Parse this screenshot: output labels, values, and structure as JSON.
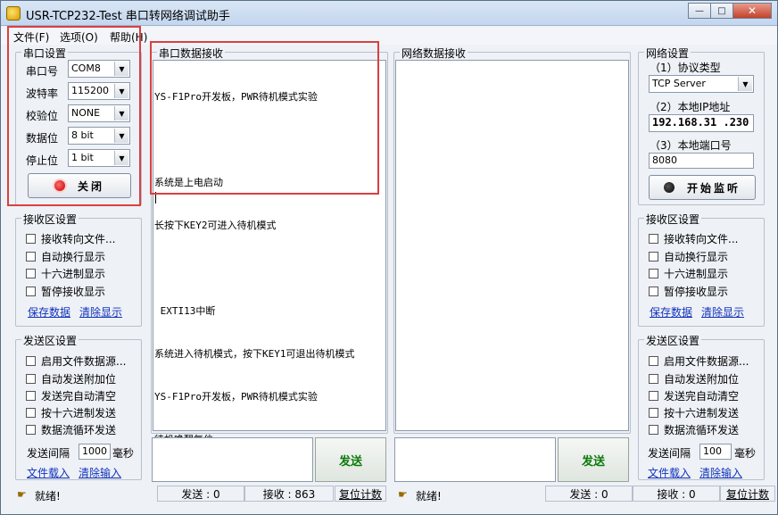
{
  "window": {
    "title": "USR-TCP232-Test 串口转网络调试助手",
    "buttons": {
      "minimize": "—",
      "maximize": "□",
      "close": "✕"
    }
  },
  "menu": [
    "文件(F)",
    "选项(O)",
    "帮助(H)"
  ],
  "serial_settings": {
    "title": "串口设置",
    "port": {
      "label": "串口号",
      "value": "COM8"
    },
    "baud": {
      "label": "波特率",
      "value": "115200"
    },
    "parity": {
      "label": "校验位",
      "value": "NONE"
    },
    "databits": {
      "label": "数据位",
      "value": "8 bit"
    },
    "stopbits": {
      "label": "停止位",
      "value": "1 bit"
    },
    "close_button": "关闭"
  },
  "serial_recv_settings": {
    "title": "接收区设置",
    "options": [
      "接收转向文件...",
      "自动换行显示",
      "十六进制显示",
      "暂停接收显示"
    ],
    "save_link": "保存数据",
    "clear_link": "清除显示"
  },
  "serial_send_settings": {
    "title": "发送区设置",
    "options": [
      "启用文件数据源...",
      "自动发送附加位",
      "发送完自动清空",
      "按十六进制发送",
      "数据流循环发送"
    ],
    "interval_label": "发送间隔",
    "interval_value": "1000",
    "interval_unit": "毫秒",
    "load_link": "文件载入",
    "clear_link": "清除输入"
  },
  "serial_recv": {
    "title": "串口数据接收",
    "lines": [
      "YS-F1Pro开发板，PWR待机模式实验",
      "",
      "系统是上电启动",
      "长按下KEY2可进入待机模式",
      "",
      " EXTI13中断",
      "系统进入待机模式，按下KEY1可退出待机模式",
      "YS-F1Pro开发板，PWR待机模式实验",
      "待机唤醒复位"
    ]
  },
  "net_recv": {
    "title": "网络数据接收"
  },
  "net_settings": {
    "title": "网络设置",
    "protocol_label": "（1）协议类型",
    "protocol_value": "TCP Server",
    "ip_label": "（2）本地IP地址",
    "ip_value": "192.168.31 .230",
    "port_label": "（3）本地端口号",
    "port_value": "8080",
    "listen_button": "开始监听"
  },
  "net_recv_settings": {
    "title": "接收区设置",
    "options": [
      "接收转向文件...",
      "自动换行显示",
      "十六进制显示",
      "暂停接收显示"
    ],
    "save_link": "保存数据",
    "clear_link": "清除显示"
  },
  "net_send_settings": {
    "title": "发送区设置",
    "options": [
      "启用文件数据源...",
      "自动发送附加位",
      "发送完自动清空",
      "按十六进制发送",
      "数据流循环发送"
    ],
    "interval_label": "发送间隔",
    "interval_value": "100",
    "interval_unit": "毫秒",
    "load_link": "文件载入",
    "clear_link": "清除输入"
  },
  "send_button": "发送",
  "status_left": {
    "text": "就绪!",
    "sent": "发送 : 0",
    "recv": "接收 : 863",
    "reset": "复位计数"
  },
  "status_right": {
    "text": "就绪!",
    "sent": "发送 : 0",
    "recv": "接收 : 0",
    "reset": "复位计数"
  },
  "colors": {
    "highlight_box": "#d94040",
    "send_text": "#0b7a0b",
    "link": "#1133bb"
  }
}
